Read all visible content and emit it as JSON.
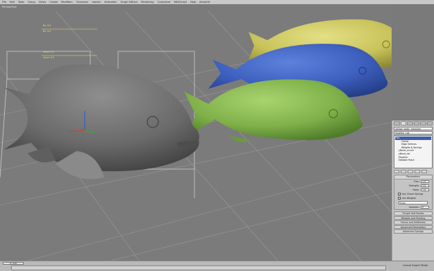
{
  "menu": [
    "File",
    "Edit",
    "Tools",
    "Group",
    "Views",
    "Create",
    "Modifiers",
    "Character",
    "reactor",
    "Animation",
    "Graph Editors",
    "Rendering",
    "Customize",
    "MAXScript",
    "Help",
    "Aerostrit"
  ],
  "viewport": {
    "label": "Perspective"
  },
  "grid_labels": {
    "a": "Bn: 6.0",
    "b": "Bn: 6.0",
    "c": "value: 6.0",
    "d": "value: 6.0"
  },
  "panel": {
    "object_name": "yellow_body_morpher",
    "modifier_list": "Modifier List",
    "stack": [
      {
        "label": "Flex",
        "style": "sel"
      },
      {
        "label": "Center",
        "style": "sub2"
      },
      {
        "label": "Edge Vertices",
        "style": "sub2"
      },
      {
        "label": "Weights & Springs",
        "style": "sub2"
      },
      {
        "label": "yBend_curver",
        "style": "sub"
      },
      {
        "label": "yBend_rbt",
        "style": "sub"
      },
      {
        "label": "Morpher",
        "style": "sub"
      },
      {
        "label": "Editable Patch",
        "style": "sub"
      }
    ],
    "params_title": "Parameters",
    "flex_label": "Flex:",
    "flex_val": "1.0",
    "strength_label": "Strength:",
    "strength_val": "1.0",
    "sway_label": "Sway:",
    "sway_val": "7.0",
    "chase_label": "Use Chase Springs",
    "weights_label": "Use Weights",
    "solver": "Euler",
    "samples_label": "Samples:",
    "samples_val": "5",
    "rollouts": [
      "Simple Soft Bodies",
      "Weights and Painting",
      "Forces and Deflectors",
      "Advanced Parameters",
      "Advanced Springs"
    ]
  },
  "timeline": {
    "frame": "0 / 100",
    "status": "Cancel Expert Mode"
  },
  "colors": {
    "yellow": "#c8c35a",
    "blue": "#3d5fbd",
    "green": "#7fb04a",
    "gray": "#6e6e6e"
  }
}
